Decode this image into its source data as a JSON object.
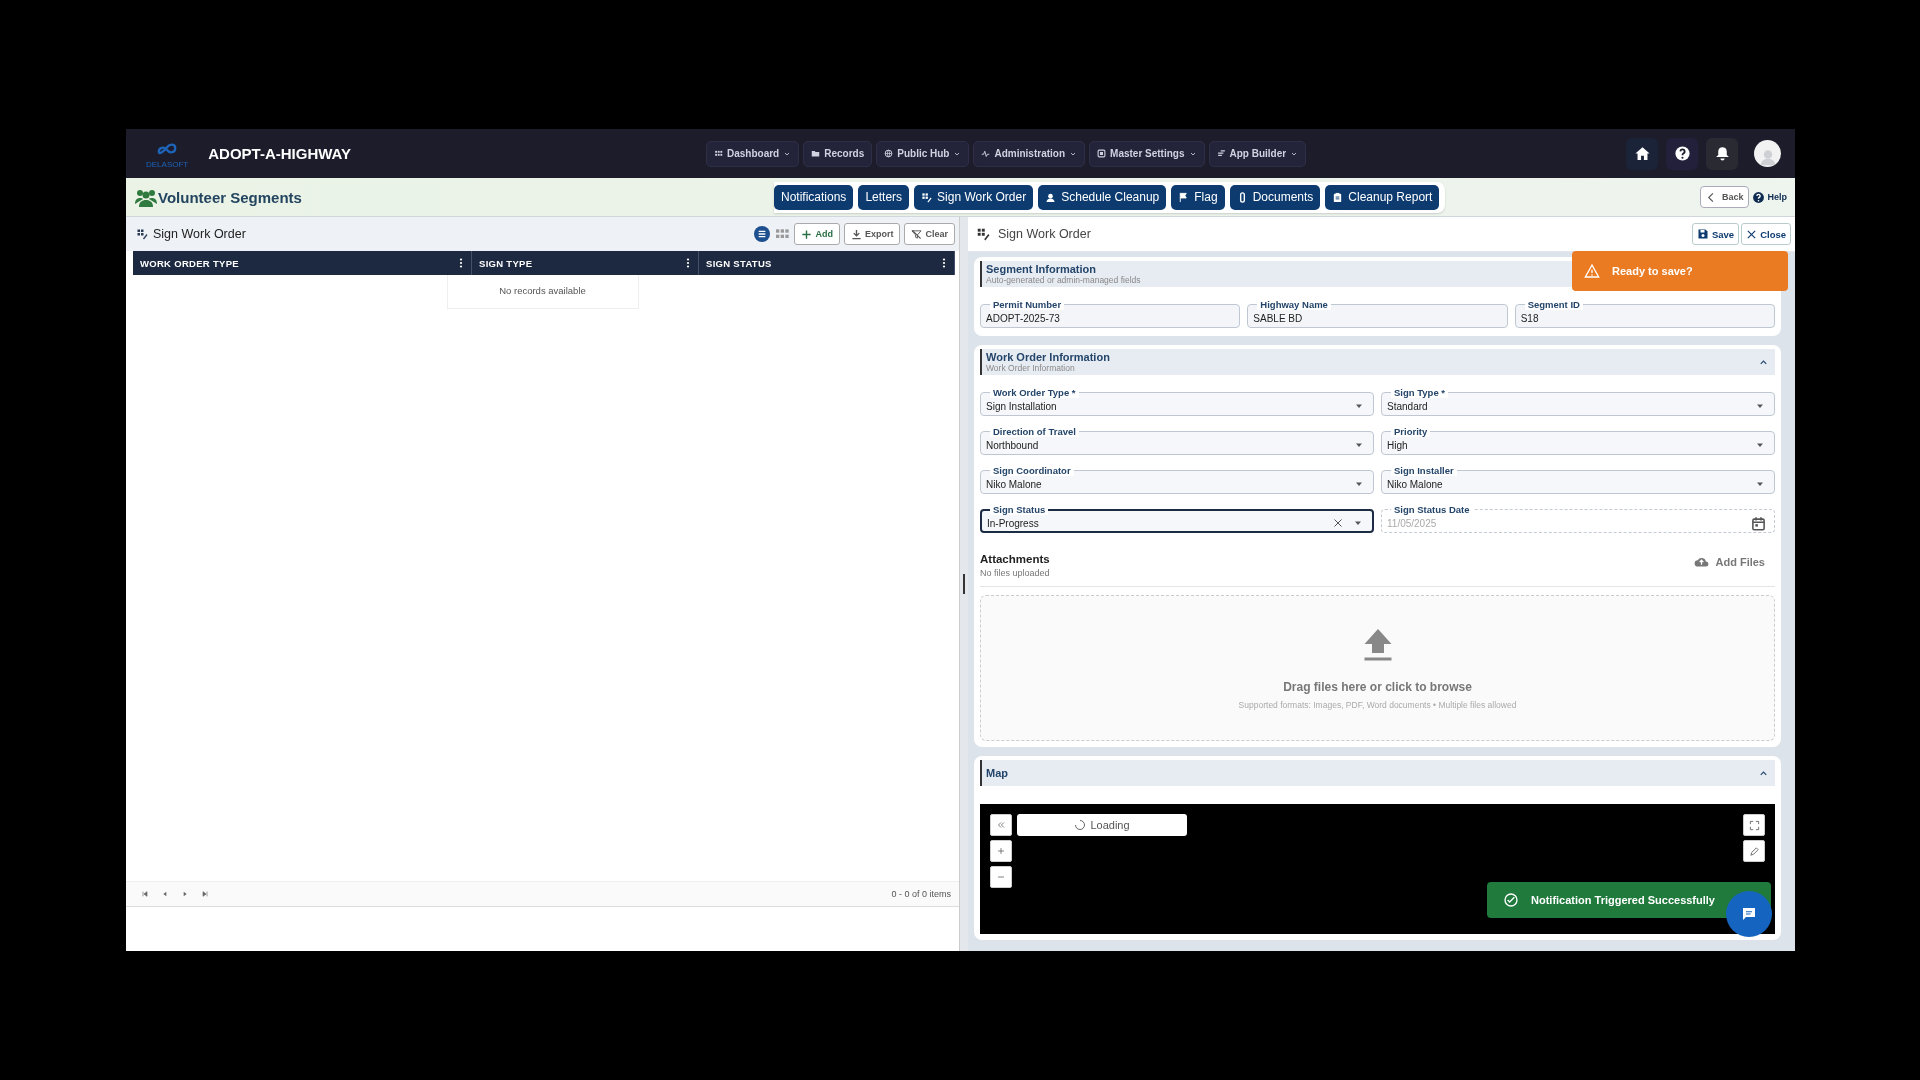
{
  "topbar": {
    "logo_text": "DELASOFT",
    "title": "ADOPT-A-HIGHWAY",
    "nav": [
      {
        "label": "Dashboard",
        "dropdown": true
      },
      {
        "label": "Records",
        "dropdown": false
      },
      {
        "label": "Public Hub",
        "dropdown": true
      },
      {
        "label": "Administration",
        "dropdown": true
      },
      {
        "label": "Master Settings",
        "dropdown": true
      },
      {
        "label": "App Builder",
        "dropdown": true
      }
    ]
  },
  "page": {
    "title": "Volunteer Segments",
    "actions": [
      {
        "label": "Notifications",
        "kind": "plain"
      },
      {
        "label": "Letters",
        "kind": "plain"
      },
      {
        "label": "Sign Work Order",
        "kind": "grid"
      },
      {
        "label": "Schedule Cleanup",
        "kind": "person"
      },
      {
        "label": "Flag",
        "kind": "flag"
      },
      {
        "label": "Documents",
        "kind": "clip"
      },
      {
        "label": "Cleanup Report",
        "kind": "report"
      }
    ],
    "back": "Back",
    "help": "Help"
  },
  "list_panel": {
    "title": "Sign Work Order",
    "views": [
      {
        "kind": "list",
        "selected": true
      },
      {
        "kind": "grid",
        "selected": false
      }
    ],
    "buttons": [
      {
        "label": "Add",
        "kind": "add"
      },
      {
        "label": "Export",
        "kind": "export"
      },
      {
        "label": "Clear",
        "kind": "clear"
      }
    ],
    "columns": [
      "WORK ORDER TYPE",
      "SIGN TYPE",
      "SIGN STATUS"
    ],
    "empty": "No records available",
    "pager": "0 - 0 of 0 items"
  },
  "form": {
    "title": "Sign Work Order",
    "save": "Save",
    "close": "Close",
    "segment": {
      "title": "Segment Information",
      "subtitle": "Auto-generated or admin-managed fields",
      "fields": [
        {
          "label": "Permit Number",
          "value": "ADOPT-2025-73",
          "kind": "text"
        },
        {
          "label": "Highway Name",
          "value": "SABLE BD",
          "kind": "text"
        },
        {
          "label": "Segment ID",
          "value": "S18",
          "kind": "text"
        }
      ]
    },
    "work_order": {
      "title": "Work Order Information",
      "subtitle": "Work Order Information",
      "expanded": true,
      "fields": [
        {
          "label": "Work Order Type *",
          "value": "Sign Installation",
          "kind": "select",
          "focused": false
        },
        {
          "label": "Sign Type *",
          "value": "Standard",
          "kind": "select",
          "focused": false
        },
        {
          "label": "Direction of Travel",
          "value": "Northbound",
          "kind": "select",
          "focused": false
        },
        {
          "label": "Priority",
          "value": "High",
          "kind": "select",
          "focused": false
        },
        {
          "label": "Sign Coordinator",
          "value": "Niko Malone",
          "kind": "select",
          "focused": false
        },
        {
          "label": "Sign Installer",
          "value": "Niko Malone",
          "kind": "select",
          "focused": false
        },
        {
          "label": "Sign Status",
          "value": "In-Progress",
          "kind": "select",
          "focused": true,
          "clearable": true
        },
        {
          "label": "Sign Status Date",
          "value": "11/05/2025",
          "kind": "date",
          "disabled": true
        }
      ]
    },
    "attachments": {
      "title": "Attachments",
      "status": "No files uploaded",
      "add": "Add Files",
      "drop": "Drag files here or click to browse",
      "formats": "Supported formats: Images, PDF, Word documents • Multiple files allowed"
    },
    "map": {
      "title": "Map",
      "expanded": true,
      "loading": "Loading"
    }
  },
  "toasts": [
    {
      "kind": "warning",
      "text": "Ready to save?"
    },
    {
      "kind": "success",
      "text": "Notification Triggered Successfully"
    }
  ]
}
